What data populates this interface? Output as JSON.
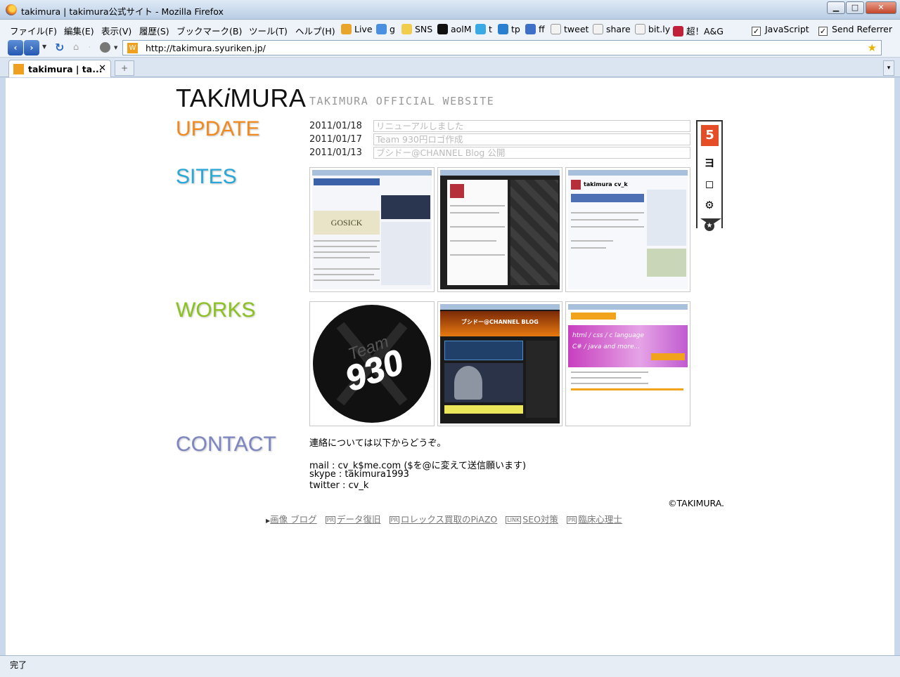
{
  "window": {
    "title": "takimura | takimura公式サイト - Mozilla Firefox",
    "min": "▁",
    "max": "□",
    "close": "✕"
  },
  "menu": [
    "ファイル(F)",
    "編集(E)",
    "表示(V)",
    "履歴(S)",
    "ブックマーク(B)",
    "ツール(T)",
    "ヘルプ(H)"
  ],
  "bookmarks": [
    {
      "label": "Live",
      "icon": "windows-live-icon",
      "color": "#e8a52a"
    },
    {
      "label": "g",
      "icon": "google-icon",
      "color": "#4a8fe0"
    },
    {
      "label": "SNS",
      "icon": "folder-icon",
      "color": "#f2cc4c"
    },
    {
      "label": "aolM",
      "icon": "aol-icon",
      "color": "#111111"
    },
    {
      "label": "t",
      "icon": "twitter-bird-icon",
      "color": "#3ba9e4"
    },
    {
      "label": "tp",
      "icon": "twitpic-icon",
      "color": "#2a7fd0"
    },
    {
      "label": "ff",
      "icon": "friendfeed-icon",
      "color": "#3d70c6"
    },
    {
      "label": "tweet",
      "icon": "page-icon",
      "color": "#f2f2f2"
    },
    {
      "label": "share",
      "icon": "page-icon",
      "color": "#f2f2f2"
    },
    {
      "label": "bit.ly",
      "icon": "page-icon",
      "color": "#f2f2f2"
    },
    {
      "label": "超！A&G",
      "icon": "agqr-icon",
      "color": "#c0203a"
    }
  ],
  "toggles": [
    {
      "label": "JavaScript",
      "checked": "✓"
    },
    {
      "label": "Send Referrer",
      "checked": "✓"
    }
  ],
  "nav": {
    "back": "‹",
    "forward": "›",
    "url": "http://takimura.syuriken.jp/",
    "favicon_letter": "W"
  },
  "tab": {
    "label": "takimura | ta...",
    "close": "✕",
    "new": "+",
    "list": "▾"
  },
  "status": "完了",
  "page": {
    "logo_a": "TAK",
    "logo_i": "i",
    "logo_b": "MURA",
    "logo_sub": "TAKIMURA OFFICIAL WEBSITE",
    "sections": {
      "update": "UPDATE",
      "sites": "SITES",
      "works": "WORKS",
      "contact": "CONTACT"
    },
    "updates": [
      {
        "date": "2011/01/18",
        "text": "リニューアルしました"
      },
      {
        "date": "2011/01/17",
        "text": "Team 930円ロゴ作成"
      },
      {
        "date": "2011/01/13",
        "text": "ブシドー@CHANNEL Blog 公開"
      }
    ],
    "badge": {
      "html5": "5",
      "i1": "ヨ",
      "i2": "◻",
      "i3": "⚙",
      "star": "★"
    },
    "sites": [
      {
        "name": "site-thumb-blog",
        "bg": "#f4f6fa",
        "accent": "#3b62a8"
      },
      {
        "name": "site-thumb-twitter",
        "bg": "#1f1f1f",
        "accent": "#3d3d3d"
      },
      {
        "name": "site-thumb-profile",
        "bg": "#f7f8fb",
        "accent": "#4d6fb3"
      }
    ],
    "works": [
      {
        "name": "work-thumb-team930-logo",
        "text": "930",
        "team": "Team"
      },
      {
        "name": "work-thumb-bushido-channel",
        "bg": "#1a1a1a",
        "accent": "#e87a10"
      },
      {
        "name": "work-thumb-language-site",
        "bg": "#ffffff",
        "accent": "#d455c8"
      }
    ],
    "contact": {
      "intro": "連絡については以下からどうぞ。",
      "mail": "mail : cv_k$me.com ($を@に変えて送信願います)",
      "skype": "skype : takimura1993",
      "twitter": "twitter : cv_k"
    },
    "copyright": "©TAKIMURA.",
    "footer": [
      {
        "tag": "▶",
        "label": "画像 ブログ"
      },
      {
        "tag": "PR",
        "label": "データ復旧"
      },
      {
        "tag": "PR",
        "label": "ロレックス買取のPiAZO"
      },
      {
        "tag": "LINK",
        "label": "SEO対策"
      },
      {
        "tag": "PR",
        "label": "臨床心理士"
      }
    ]
  }
}
